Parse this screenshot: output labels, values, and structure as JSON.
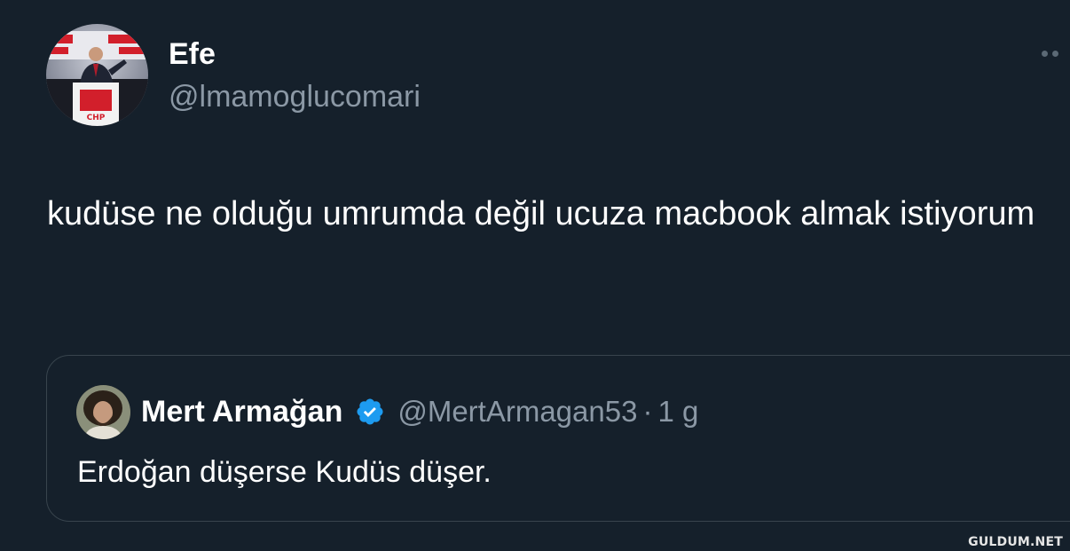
{
  "tweet": {
    "display_name": "Efe",
    "handle": "@lmamoglucomari",
    "text": "kudüse ne olduğu umrumda değil ucuza macbook almak istiyorum",
    "avatar_icon": "profile-photo-speaker-at-podium",
    "more_icon": "more-dots-icon"
  },
  "quote": {
    "display_name": "Mert Armağan",
    "handle": "@MertArmagan53",
    "separator": "·",
    "time": "1 g",
    "text": "Erdoğan düşerse Kudüs düşer.",
    "verified_icon": "verified-badge-icon",
    "verified_color": "#1d9bf0"
  },
  "watermark": "GULDUM.NET",
  "colors": {
    "background": "#15202b",
    "primary_text": "#ffffff",
    "secondary_text": "#8b98a5",
    "border": "#38444d"
  }
}
